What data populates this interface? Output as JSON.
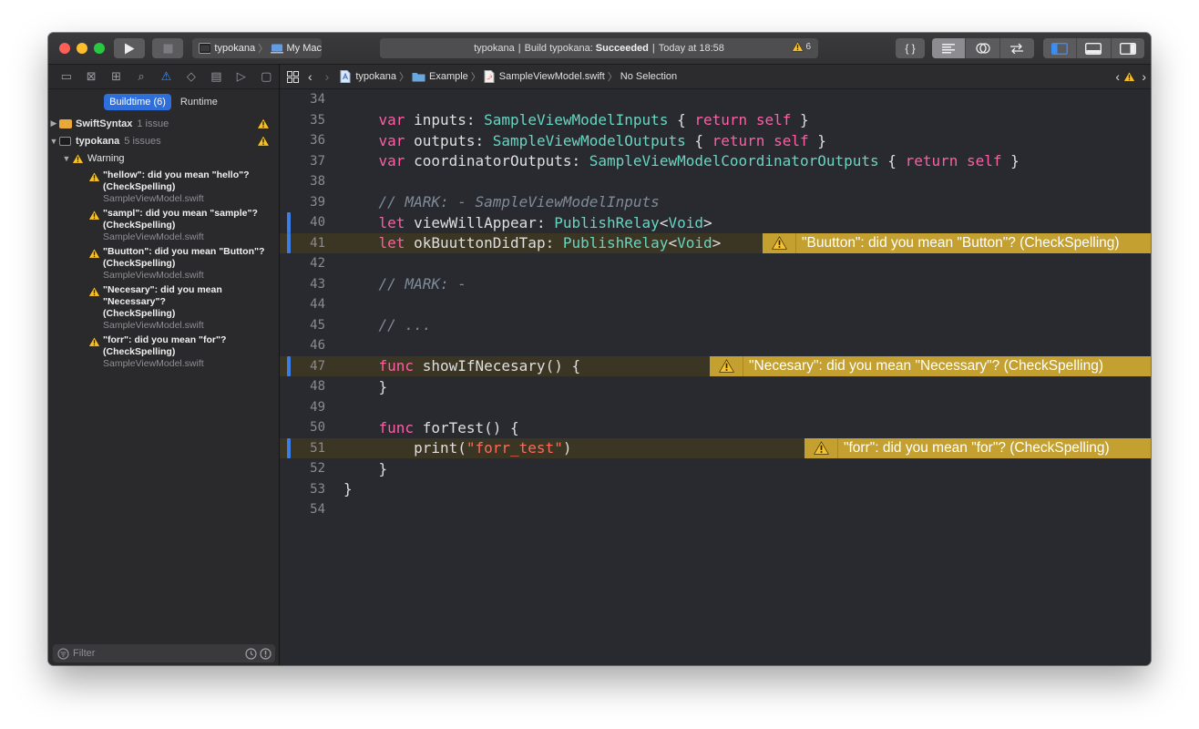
{
  "toolbar": {
    "scheme_target": "typokana",
    "scheme_device": "My Mac",
    "activity_project": "typokana",
    "activity_prefix": "Build typokana:",
    "activity_status": "Succeeded",
    "activity_time": "Today at 18:58",
    "warning_count": "6",
    "editor_mode_code": "{ }"
  },
  "navigator": {
    "scope_selected": "Buildtime (6)",
    "scope_other": "Runtime",
    "groups": [
      {
        "name": "SwiftSyntax",
        "count": "1 issue"
      },
      {
        "name": "typokana",
        "count": "5 issues"
      }
    ],
    "category": "Warning",
    "issues": [
      {
        "message": "\"hellow\": did you mean \"hello\"? (CheckSpelling)",
        "file": "SampleViewModel.swift"
      },
      {
        "message": "\"sampl\": did you mean \"sample\"? (CheckSpelling)",
        "file": "SampleViewModel.swift"
      },
      {
        "message": "\"Buutton\": did you mean \"Button\"? (CheckSpelling)",
        "file": "SampleViewModel.swift"
      },
      {
        "message": "\"Necesary\": did you mean \"Necessary\"? (CheckSpelling)",
        "file": "SampleViewModel.swift"
      },
      {
        "message": "\"forr\": did you mean \"for\"? (CheckSpelling)",
        "file": "SampleViewModel.swift"
      }
    ],
    "filter_placeholder": "Filter"
  },
  "jumpbar": {
    "crumbs": [
      "typokana",
      "Example",
      "SampleViewModel.swift",
      "No Selection"
    ]
  },
  "editor": {
    "line_numbers": [
      "34",
      "35",
      "36",
      "37",
      "38",
      "39",
      "40",
      "41",
      "42",
      "43",
      "44",
      "45",
      "46",
      "47",
      "48",
      "49",
      "50",
      "51",
      "52",
      "53",
      "54"
    ],
    "banners": [
      {
        "line": "41",
        "text": "\"Buutton\": did you mean \"Button\"? (CheckSpelling)"
      },
      {
        "line": "47",
        "text": "\"Necesary\": did you mean \"Necessary\"? (CheckSpelling)"
      },
      {
        "line": "51",
        "text": "\"forr\": did you mean \"for\"? (CheckSpelling)"
      }
    ],
    "tokens": {
      "var": "var",
      "let": "let",
      "func": "func",
      "return": "return",
      "self": "self",
      "inputs": "inputs:",
      "outputs": "outputs:",
      "coordinatorOutputs": "coordinatorOutputs:",
      "t_inputs": "SampleViewModelInputs",
      "t_outputs": "SampleViewModelOutputs",
      "t_coord": "SampleViewModelCoordinatorOutputs",
      "mark_inputs": "// MARK: - SampleViewModelInputs",
      "viewWillAppear": "viewWillAppear:",
      "okBuuttonDidTap": "okBuuttonDidTap:",
      "publishRelay": "PublishRelay",
      "void": "Void",
      "mark_empty": "// MARK: -",
      "ellipsis": "// ...",
      "showIfNecesary": "showIfNecesary() {",
      "forTest": "forTest() {",
      "print_open": "print(",
      "forr_test": "\"forr_test\"",
      "print_close": ")",
      "brace_open": "{",
      "brace_close": "}",
      "lt": "<",
      "gt": ">"
    }
  },
  "colors": {
    "keyword": "#fc5fa3",
    "type": "#67d5c1",
    "comment": "#7f8c98",
    "string": "#fc6a5d",
    "warning_banner": "#c3a02f",
    "accent": "#3b8ef6"
  }
}
